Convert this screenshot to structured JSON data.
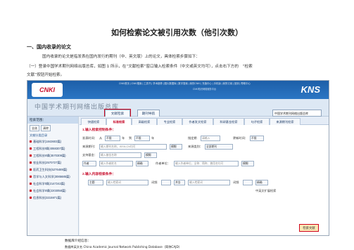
{
  "document": {
    "title": "如何检索论文被引用次数（他引次数）",
    "section_heading": "一、国内收录的论文",
    "paragraph_1": "国内收录的论文是指发表在国内发行的期刊（中、英文版）上的论文，具体检索步骤如下：",
    "paragraph_2": "（一）登录中国学术期刊网络出版总库，如图 1 所示，在“文献检索”窗口输入检索条件（中文或英文均可），点击右下方的　“检索",
    "paragraph_3": "文献”按钮开始检索。"
  },
  "screenshot": {
    "logo": "CNKI",
    "top_links": "CNKI首页 | CNKI搜索 | 工具书 | 学术趋势 | 图片数据库 | 数字搜索 | 我的CNKI | 充值中心 | 手机版 | 我的订阅 | 回到 | 帮助中心",
    "top_subtitle": "CNKI知识网络服务平台",
    "brand": "KNS",
    "db_title": "中国学术期刊网络出版总库",
    "doc_search_button": "文献检索",
    "search_button": "期刊导航",
    "db_select": "中国学术期刊网络出版总库",
    "left_panel": {
      "header": "检索范围：",
      "btn_all": "全选",
      "btn_clear": "清除",
      "sub": "文献分类目录",
      "items": [
        "基础科学(1843603篇)",
        "工程科技I辑(4068307篇)",
        "工程科技II辑(3570309篇)",
        "农业科技(2570727篇)",
        "医药卫生科技(5276489篇)",
        "哲学与人文科学(3085685篇)",
        "社会科学I辑(2147242篇)",
        "社会科学II辑(2203058篇)",
        "信息科技(3215971篇)"
      ]
    },
    "tabs": [
      "快速检索",
      "标准检索",
      "高级检索",
      "专业检索",
      "作者发文检索",
      "科研基金检索",
      "句子检索",
      "来源期刊检索"
    ],
    "section_1": "1.输入检索控制条件：",
    "section_2": "2.输入内容检索条件：",
    "rows": {
      "pub_time_label": "发表时间：",
      "from": "从",
      "to": "到",
      "year_unlimited": "不限",
      "year_label": "年",
      "specify": "指定期",
      "please_input": "请输入",
      "update_time": "更新时间：",
      "source_label": "来源期刊：",
      "source_placeholder": "输入期刊名称，ISSN,CN均可",
      "fuzzy": "模糊",
      "source_category": "来源类别：",
      "all_journals": "全部期刊",
      "fund_label": "支持基金：",
      "fund_placeholder": "输入基金名称",
      "author": "作者",
      "name_placeholder": "输入作者姓名",
      "exact": "精确",
      "author_unit": "作者单位：",
      "unit_placeholder": "输入作者单位，全称、简称、曾用名均可",
      "topic": "主题",
      "content_placeholder": "输入检索词",
      "word_freq": "词频",
      "and": "并含",
      "expand": "中英文扩展检索",
      "search_docs": "检索文献"
    },
    "footer_1": "数据库介绍信息：",
    "footer_2": "数据库英文名 China Academic Journal Network Publishing Database（简称CAJD）"
  }
}
